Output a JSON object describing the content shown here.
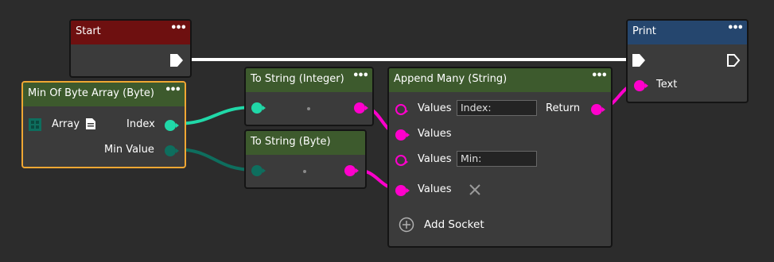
{
  "nodes": {
    "start": {
      "title": "Start"
    },
    "print": {
      "title": "Print",
      "text_label": "Text"
    },
    "min_of_byte_array": {
      "title": "Min Of Byte Array (Byte)",
      "array_label": "Array",
      "index_label": "Index",
      "min_value_label": "Min Value"
    },
    "to_string_integer": {
      "title": "To String (Integer)"
    },
    "to_string_byte": {
      "title": "To String (Byte)"
    },
    "append_many": {
      "title": "Append Many (String)",
      "values_label": "Values",
      "return_label": "Return",
      "value1_input": "Index:",
      "value3_input": "Min:",
      "add_socket_label": "Add Socket"
    }
  },
  "menu_icon": "•••",
  "colors": {
    "background": "#2c2c2c",
    "node_body": "#3b3b3b",
    "header_green": "#3d5a2d",
    "header_red": "#6e1010",
    "header_blue": "#25466e",
    "selected_border": "#f0a733",
    "string_pin": "#ff00cc",
    "integer_pin": "#20d8a8",
    "byte_pin": "#0e6e5e",
    "exec_wire": "#ffffff"
  }
}
